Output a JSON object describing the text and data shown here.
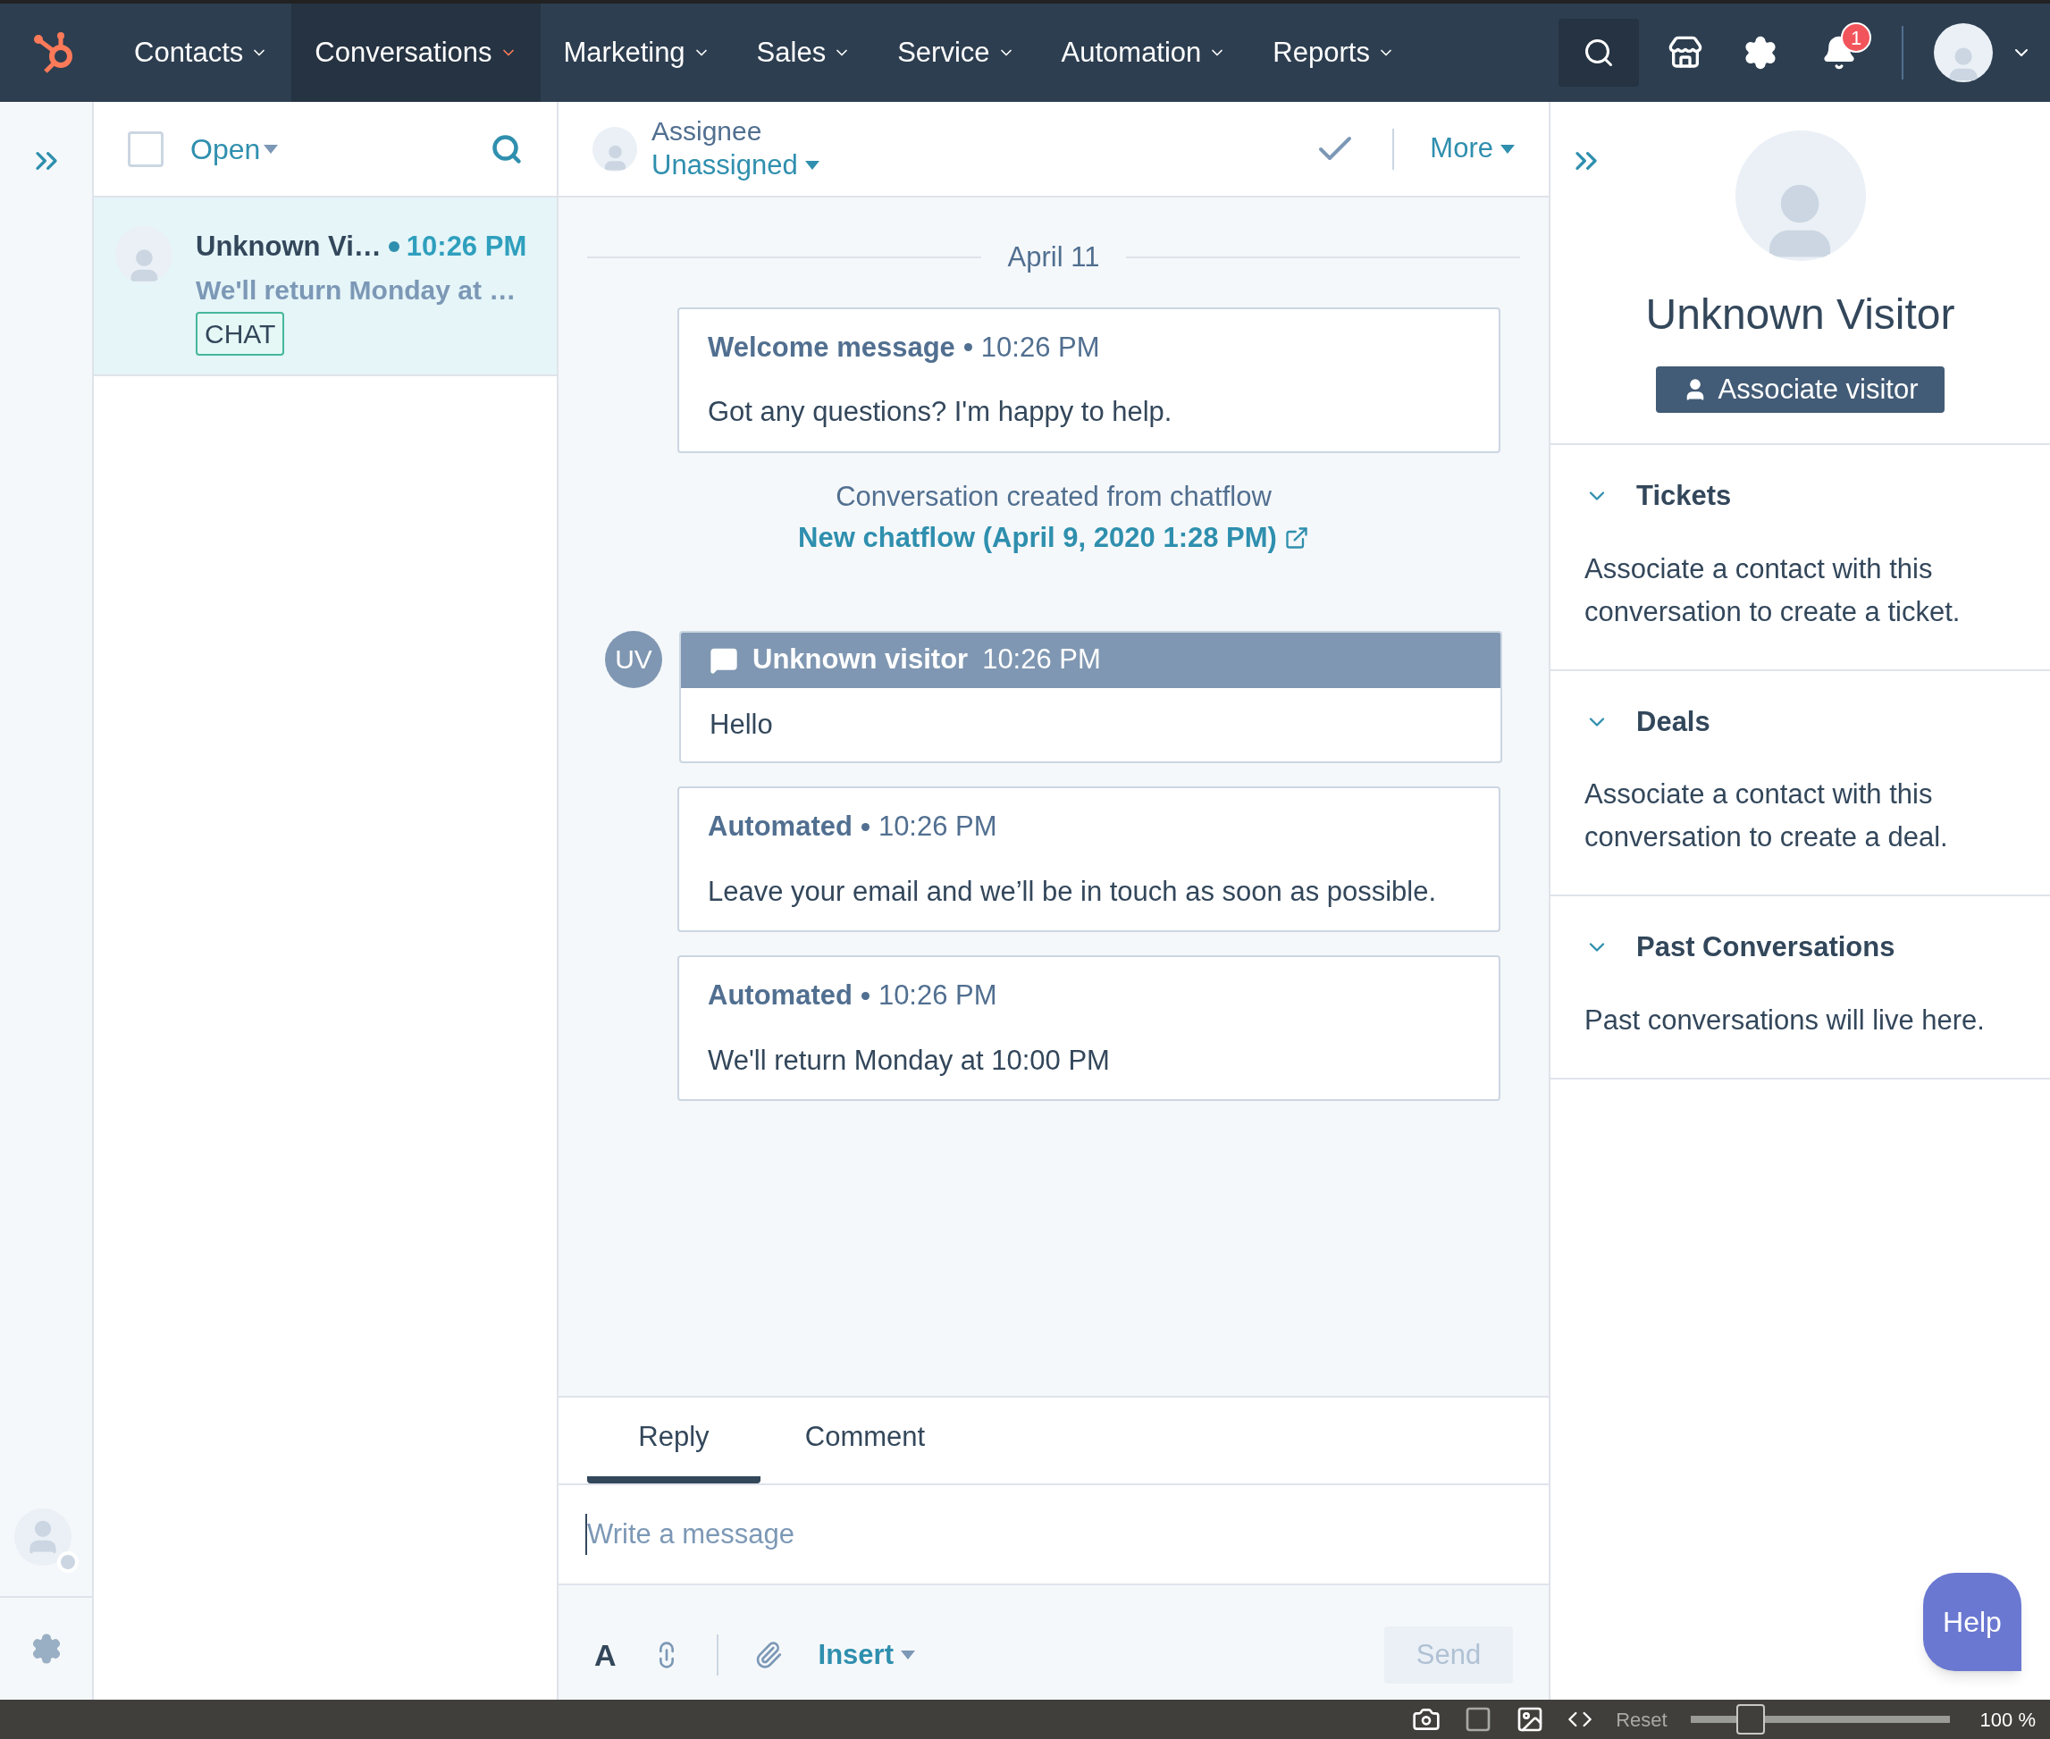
{
  "nav": {
    "items": [
      {
        "label": "Contacts",
        "selected": false
      },
      {
        "label": "Conversations",
        "selected": true
      },
      {
        "label": "Marketing",
        "selected": false
      },
      {
        "label": "Sales",
        "selected": false
      },
      {
        "label": "Service",
        "selected": false
      },
      {
        "label": "Automation",
        "selected": false
      },
      {
        "label": "Reports",
        "selected": false
      }
    ],
    "notification_count": "1"
  },
  "inbox": {
    "filter": "Open",
    "select_all_checked": false,
    "conversations": [
      {
        "name": "Unknown Vi…",
        "time": "10:26 PM",
        "preview": "We'll return Monday at …",
        "tag": "CHAT",
        "selected": true
      }
    ]
  },
  "thread": {
    "assignee_label": "Assignee",
    "assignee": "Unassigned",
    "more": "More",
    "date": "April 11",
    "messages": [
      {
        "kind": "card",
        "sender": "Welcome message",
        "time": "10:26 PM",
        "body": "Got any questions? I'm happy to help."
      },
      {
        "kind": "system",
        "text": "Conversation created from chatflow",
        "link": "New chatflow (April 9, 2020 1:28 PM)"
      },
      {
        "kind": "visitor",
        "initials": "UV",
        "sender": "Unknown visitor",
        "time": "10:26 PM",
        "body": "Hello"
      },
      {
        "kind": "card",
        "sender": "Automated",
        "time": "10:26 PM",
        "body": "Leave your email and we’ll be in touch as soon as possible."
      },
      {
        "kind": "card",
        "sender": "Automated",
        "time": "10:26 PM",
        "body": "We'll return Monday at 10:00 PM"
      }
    ],
    "composer": {
      "tabs": [
        {
          "label": "Reply",
          "selected": true
        },
        {
          "label": "Comment",
          "selected": false
        }
      ],
      "placeholder": "Write a message",
      "format_glyph": "A",
      "insert": "Insert",
      "send": "Send",
      "send_disabled": true
    }
  },
  "sidebar": {
    "name": "Unknown Visitor",
    "associate": "Associate visitor",
    "sections": [
      {
        "title": "Tickets",
        "expanded": true,
        "text": "Associate a contact with this conversation to create a ticket."
      },
      {
        "title": "Deals",
        "expanded": true,
        "text": "Associate a contact with this conversation to create a deal."
      },
      {
        "title": "Past Conversations",
        "expanded": true,
        "text": "Past conversations will live here."
      }
    ]
  },
  "help": "Help",
  "status_bar": {
    "reset": "Reset",
    "level": 0.2,
    "zoom": "100 %"
  }
}
